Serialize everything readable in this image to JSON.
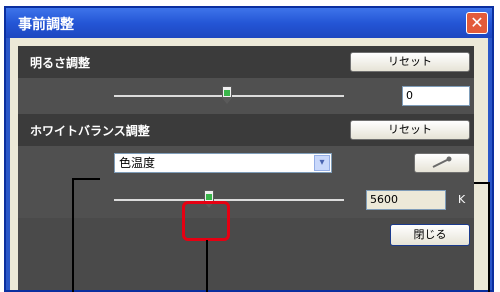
{
  "window": {
    "title": "事前調整",
    "close_glyph": "✕"
  },
  "brightness": {
    "label": "明るさ調整",
    "reset_label": "リセット",
    "value": "0"
  },
  "white_balance": {
    "label": "ホワイトバランス調整",
    "reset_label": "リセット",
    "mode_value": "色温度",
    "dropdown_arrow": "▾",
    "picker_icon": "eyedropper-icon",
    "temperature_value": "5600",
    "unit": "K"
  },
  "close_button_label": "閉じる",
  "colors": {
    "highlight": "#e60012",
    "title_bar": "#2456d6"
  }
}
